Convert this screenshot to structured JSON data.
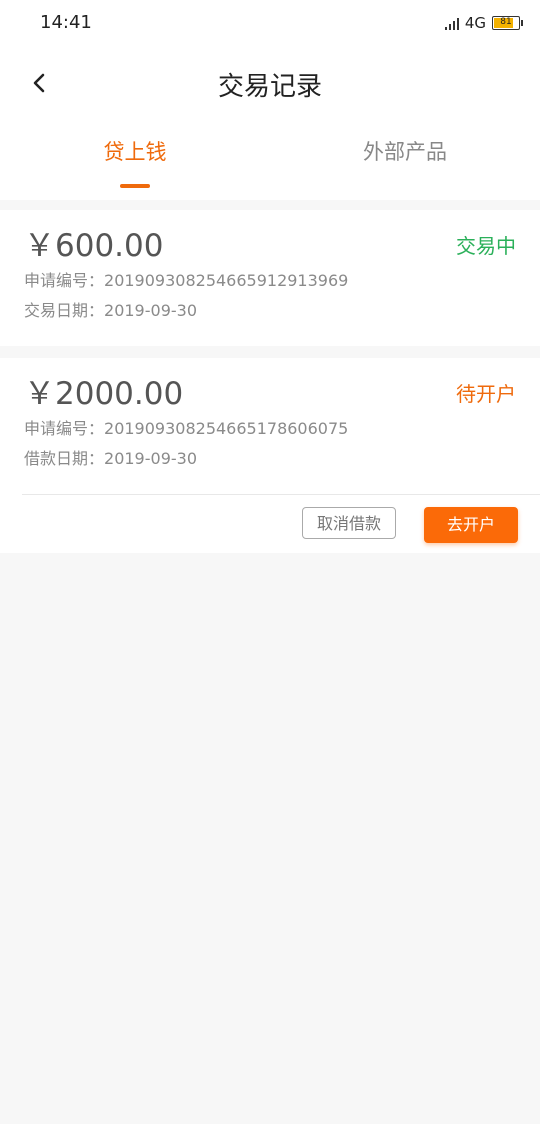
{
  "status_bar": {
    "time": "14:41",
    "network": "4G",
    "battery": "81",
    "battery_level": 0.81
  },
  "header": {
    "title": "交易记录"
  },
  "tabs": [
    {
      "label": "贷上钱",
      "active": true
    },
    {
      "label": "外部产品",
      "active": false
    }
  ],
  "colors": {
    "accent": "#ef6a0c",
    "status_green": "#2bb05a",
    "primary_button": "#fb6a08"
  },
  "records": [
    {
      "amount": "￥600.00",
      "status": "交易中",
      "info": [
        {
          "label": "申请编号：",
          "value": "20190930825466591291396​9"
        },
        {
          "label": "交易日期：",
          "value": "2019-09-30"
        }
      ]
    },
    {
      "amount": "￥2000.00",
      "status": "待开户",
      "info": [
        {
          "label": "申请编号：",
          "value": "201909308254665178606075"
        },
        {
          "label": "借款日期：",
          "value": "2019-09-30"
        }
      ],
      "actions": {
        "cancel": "取消借款",
        "open_account": "去开户"
      }
    }
  ]
}
